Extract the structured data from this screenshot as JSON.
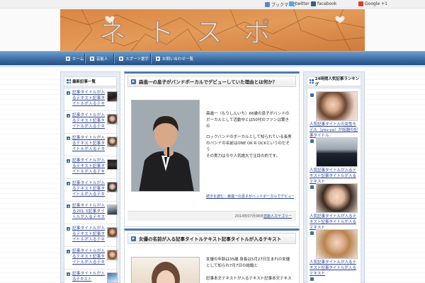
{
  "share": {
    "bookmark": "ブックマーク",
    "twitter": "twitter",
    "facebook": "facebook",
    "google": "Google +1"
  },
  "banner": {
    "logo_text": "ネトスポ"
  },
  "nav": [
    "ホーム",
    "芸能人",
    "スポーツ選手",
    "お問い合わせ一覧"
  ],
  "left_sidebar": {
    "title": "最新記事一覧",
    "items": [
      "記事タイトルが入るテキスト記事タイトルが入るテキスト",
      "記事タイトルが入るテキスト記事タイトルが入るテキスト",
      "記事タイトルが入るテキスト記事タイトルが入るテキスト",
      "記事タイトルが入るテキスト記事タイトルが入るテキスト",
      "記事タイトルが入るテキスト記事タイトルが入るテキスト",
      "記事タイトルが入る201 3記事タイトルが入るテキスト",
      "記事タイトルが入るテキスト記事タイトルが入るテキスト",
      "記事タイトルが入るテキスト記事タイトルが入るテキスト",
      "記事タイトルが入るテキスト"
    ]
  },
  "posts": [
    {
      "title": "森進一の息子がバンドボーカルでデビューしていた理由とは何か？",
      "body": [
        "森進一（もりしんいち）66歳の息子がバンドのボーカルとして活動中とは50代のファンは驚きの",
        "ロックバンドのボーカルとして知られている長男のバンドの名前はONE OK R OCKというのだそう",
        "その実力は今や人気絶大で注目の的です。"
      ],
      "more": "続きを読む：森進一の息子がバンドボーカルでデビューしていた理由とは何か？はこちら »",
      "date": "2014年07月08日",
      "category": "芸能人カテゴリー"
    },
    {
      "title": "女優の名前が入る記事タイトルテキスト記事タイトルが入るテキスト",
      "body": [
        "女優の年齢は35歳 身長は5月27日生まれの女優として知られ7月7日の結婚と",
        "記事本文テキストが入るテキスト記事本文テキスト"
      ]
    }
  ],
  "right_sidebar": {
    "title": "24時間人気記事ランキング",
    "items": [
      "人気記事タイトルの女性モデル（you-ya）が話題の記事タイトル",
      "人気記事タイトルが入るテキスト記事タイトルが入るテキスト",
      "人気記事タイトルが入るテキスト記事タイトルが入るテキスト",
      "人気記事タイトルが入るテキスト記事タイトルが入るテキスト"
    ]
  }
}
